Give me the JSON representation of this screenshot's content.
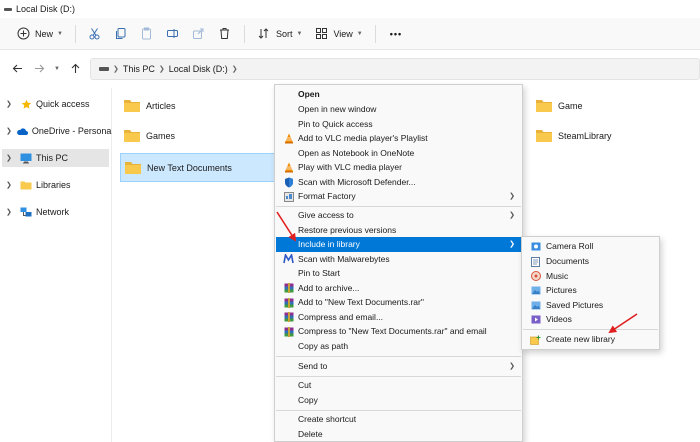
{
  "window": {
    "title": "Local Disk (D:)"
  },
  "toolbar": {
    "new_label": "New",
    "sort_label": "Sort",
    "view_label": "View",
    "more_label": "•••"
  },
  "address": {
    "path": [
      "This PC",
      "Local Disk (D:)"
    ]
  },
  "sidebar": {
    "items": [
      {
        "label": "Quick access",
        "icon": "star-icon"
      },
      {
        "label": "OneDrive - Personal",
        "icon": "cloud-icon"
      },
      {
        "label": "This PC",
        "icon": "monitor-icon",
        "selected": true
      },
      {
        "label": "Libraries",
        "icon": "folder-icon"
      },
      {
        "label": "Network",
        "icon": "network-icon"
      }
    ]
  },
  "files": [
    {
      "label": "Articles"
    },
    {
      "label": "Games"
    },
    {
      "label": "New Text Documents",
      "selected": true
    },
    {
      "label": "Game"
    },
    {
      "label": "SteamLibrary"
    }
  ],
  "context_menu": {
    "items": [
      {
        "label": "Open",
        "bold": true
      },
      {
        "label": "Open in new window"
      },
      {
        "label": "Pin to Quick access"
      },
      {
        "label": "Add to VLC media player's Playlist",
        "icon": "vlc-icon"
      },
      {
        "label": "Open as Notebook in OneNote"
      },
      {
        "label": "Play with VLC media player",
        "icon": "vlc-icon"
      },
      {
        "label": "Scan with Microsoft Defender...",
        "icon": "defender-shield-icon"
      },
      {
        "label": "Format Factory",
        "icon": "format-factory-icon",
        "submenu": true
      },
      {
        "label": "Give access to",
        "submenu": true
      },
      {
        "label": "Restore previous versions"
      },
      {
        "label": "Include in library",
        "submenu": true,
        "highlighted": true
      },
      {
        "label": "Scan with Malwarebytes",
        "icon": "malwarebytes-icon"
      },
      {
        "label": "Pin to Start"
      },
      {
        "label": "Add to archive...",
        "icon": "winrar-icon"
      },
      {
        "label": "Add to \"New Text Documents.rar\"",
        "icon": "winrar-icon"
      },
      {
        "label": "Compress and email...",
        "icon": "winrar-icon"
      },
      {
        "label": "Compress to \"New Text Documents.rar\" and email",
        "icon": "winrar-icon"
      },
      {
        "label": "Copy as path"
      },
      {
        "label": "Send to",
        "submenu": true
      },
      {
        "label": "Cut"
      },
      {
        "label": "Copy"
      },
      {
        "label": "Create shortcut"
      },
      {
        "label": "Delete"
      }
    ]
  },
  "library_submenu": {
    "items": [
      {
        "label": "Camera Roll",
        "icon": "camera-roll-icon"
      },
      {
        "label": "Documents",
        "icon": "documents-icon"
      },
      {
        "label": "Music",
        "icon": "music-icon"
      },
      {
        "label": "Pictures",
        "icon": "pictures-icon"
      },
      {
        "label": "Saved Pictures",
        "icon": "saved-pictures-icon"
      },
      {
        "label": "Videos",
        "icon": "videos-icon"
      },
      {
        "label": "Create new library",
        "icon": "new-library-icon"
      }
    ]
  },
  "colors": {
    "highlight": "#0078d7",
    "selection": "#cce8ff",
    "annotation_arrow": "#e02020",
    "folder": "#f8c94c"
  }
}
